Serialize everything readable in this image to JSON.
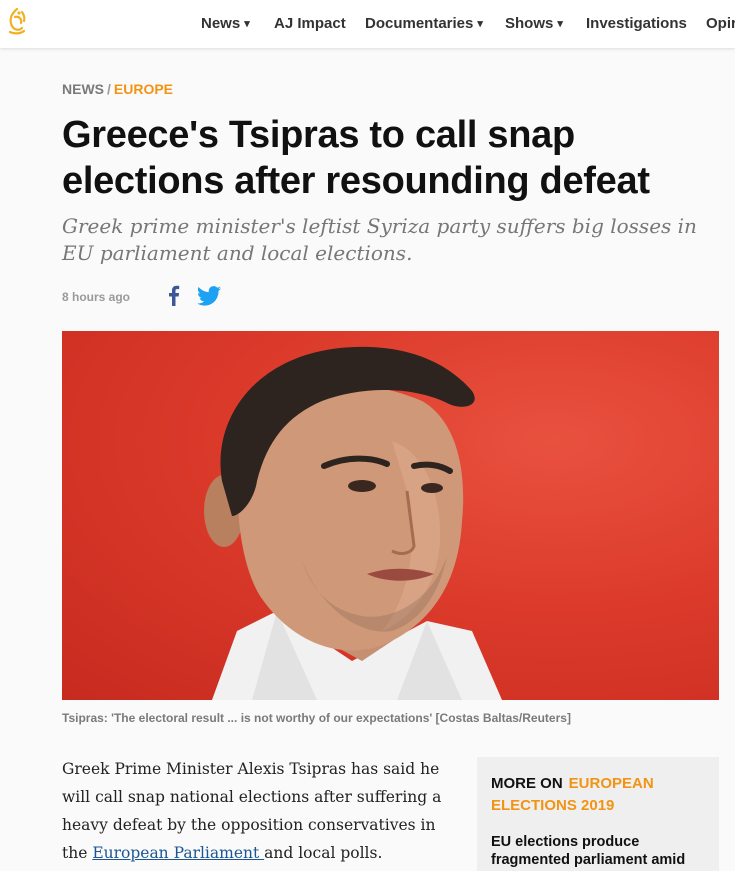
{
  "nav": {
    "items": [
      {
        "label": "News",
        "has_dropdown": true
      },
      {
        "label": "AJ Impact",
        "has_dropdown": false
      },
      {
        "label": "Documentaries",
        "has_dropdown": true
      },
      {
        "label": "Shows",
        "has_dropdown": true
      },
      {
        "label": "Investigations",
        "has_dropdown": false
      },
      {
        "label": "Opir",
        "has_dropdown": false
      }
    ],
    "caret": "▾"
  },
  "breadcrumb": {
    "section": "NEWS",
    "separator": "/",
    "subsection": "EUROPE"
  },
  "article": {
    "headline": "Greece's Tsipras to call snap elections after resounding defeat",
    "subheadline": "Greek prime minister's leftist Syriza party suffers big losses in EU parliament and local elections.",
    "timestamp": "8 hours ago",
    "image_caption": "Tsipras: 'The electoral result ... is not worthy of our expectations' [Costas Baltas/Reuters]",
    "body_before_link": "Greek Prime Minister Alexis Tsipras has said he will call snap national elections after suffering a heavy defeat by the opposition conservatives in the ",
    "body_link": "European Parliament ",
    "body_after_link": "and local polls."
  },
  "share": {
    "facebook_icon": "facebook-icon",
    "twitter_icon": "twitter-icon"
  },
  "related": {
    "label": "MORE ON",
    "topic": "EUROPEAN ELECTIONS 2019",
    "item": "EU elections produce fragmented parliament amid"
  },
  "colors": {
    "accent_orange": "#f29413",
    "link_blue": "#1a5694",
    "facebook_blue": "#3b5998",
    "twitter_blue": "#1da1f2",
    "hero_red": "#dc3b2b",
    "logo_gold": "#f2b01e"
  }
}
